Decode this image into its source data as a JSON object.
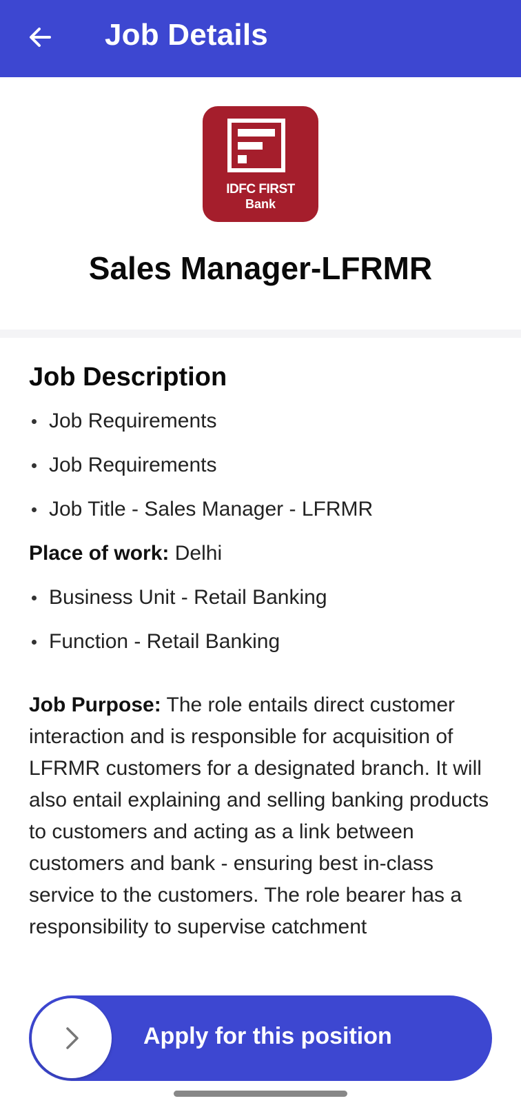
{
  "app_bar": {
    "title": "Job Details",
    "color": "#3d47d1"
  },
  "header": {
    "logo_line1": "IDFC FIRST",
    "logo_line2": "Bank",
    "job_title": "Sales Manager-LFRMR"
  },
  "description": {
    "section_title": "Job Description",
    "bullets_a": [
      "Job Requirements",
      "Job Requirements",
      "Job Title - Sales Manager - LFRMR"
    ],
    "place_label": "Place of work:",
    "place_value": " Delhi",
    "bullets_b": [
      "Business Unit - Retail Banking",
      "Function - Retail Banking"
    ],
    "purpose_label": "Job Purpose:",
    "purpose_text": " The role entails direct customer interaction and is responsible for acquisition of LFRMR customers for a designated branch. It will also entail explaining and selling banking products to customers and acting as a link between customers and bank - ensuring best in-class service to the customers. The role bearer has a responsibility to supervise catchment"
  },
  "apply": {
    "label": "Apply for this position",
    "icon": "chevron-right-icon"
  }
}
